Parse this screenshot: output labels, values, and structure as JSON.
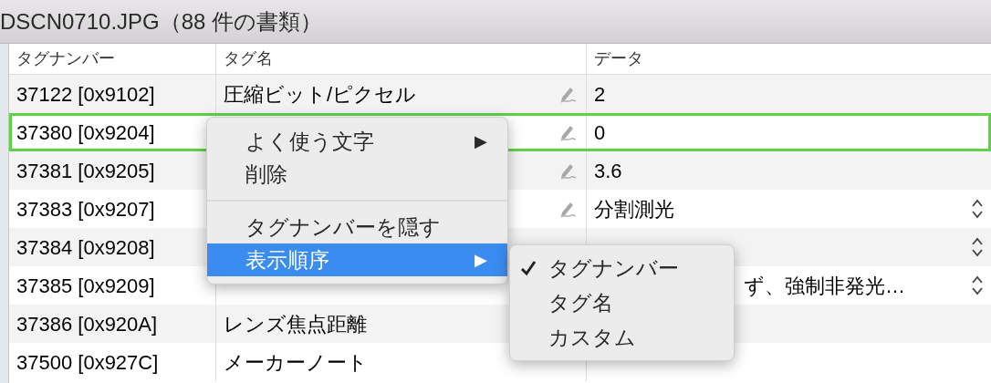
{
  "window": {
    "title": "DSCN0710.JPG（88 件の書類）"
  },
  "table": {
    "columns": [
      "タグナンバー",
      "タグ名",
      "データ"
    ],
    "rows": [
      {
        "number": "37122 [0x9102]",
        "name": "圧縮ビット/ピクセル",
        "data": "2",
        "editable": true,
        "stepper": false,
        "selected": false
      },
      {
        "number": "37380 [0x9204]",
        "data": "0",
        "editable": true,
        "stepper": false,
        "selected": true
      },
      {
        "number": "37381 [0x9205]",
        "data": "3.6",
        "editable": true,
        "stepper": false,
        "selected": false
      },
      {
        "number": "37383 [0x9207]",
        "data": "分割測光",
        "editable": true,
        "stepper": true,
        "selected": false
      },
      {
        "number": "37384 [0x9208]",
        "editable": false,
        "stepper": true,
        "selected": false
      },
      {
        "number": "37385 [0x9209]",
        "data": "ず、強制非発光…",
        "editable": false,
        "stepper": true,
        "selected": false
      },
      {
        "number": "37386 [0x920A]",
        "name": "レンズ焦点距離",
        "editable": false,
        "stepper": false,
        "selected": false
      },
      {
        "number": "37500 [0x927C]",
        "name": "メーカーノート",
        "editable": false,
        "stepper": false,
        "selected": false
      }
    ]
  },
  "context_menu": {
    "items": [
      {
        "kind": "item",
        "label": "よく使う文字",
        "arrow": "▶",
        "selected": false
      },
      {
        "kind": "item",
        "label": "削除",
        "selected": false
      },
      {
        "kind": "separator"
      },
      {
        "kind": "item",
        "label": "タグナンバーを隠す",
        "selected": false
      },
      {
        "kind": "item",
        "label": "表示順序",
        "arrow": "▶",
        "selected": true
      }
    ]
  },
  "submenu": {
    "items": [
      {
        "label": "タグナンバー",
        "checked": true
      },
      {
        "label": "タグ名",
        "checked": false
      },
      {
        "label": "カスタム",
        "checked": false
      }
    ]
  }
}
